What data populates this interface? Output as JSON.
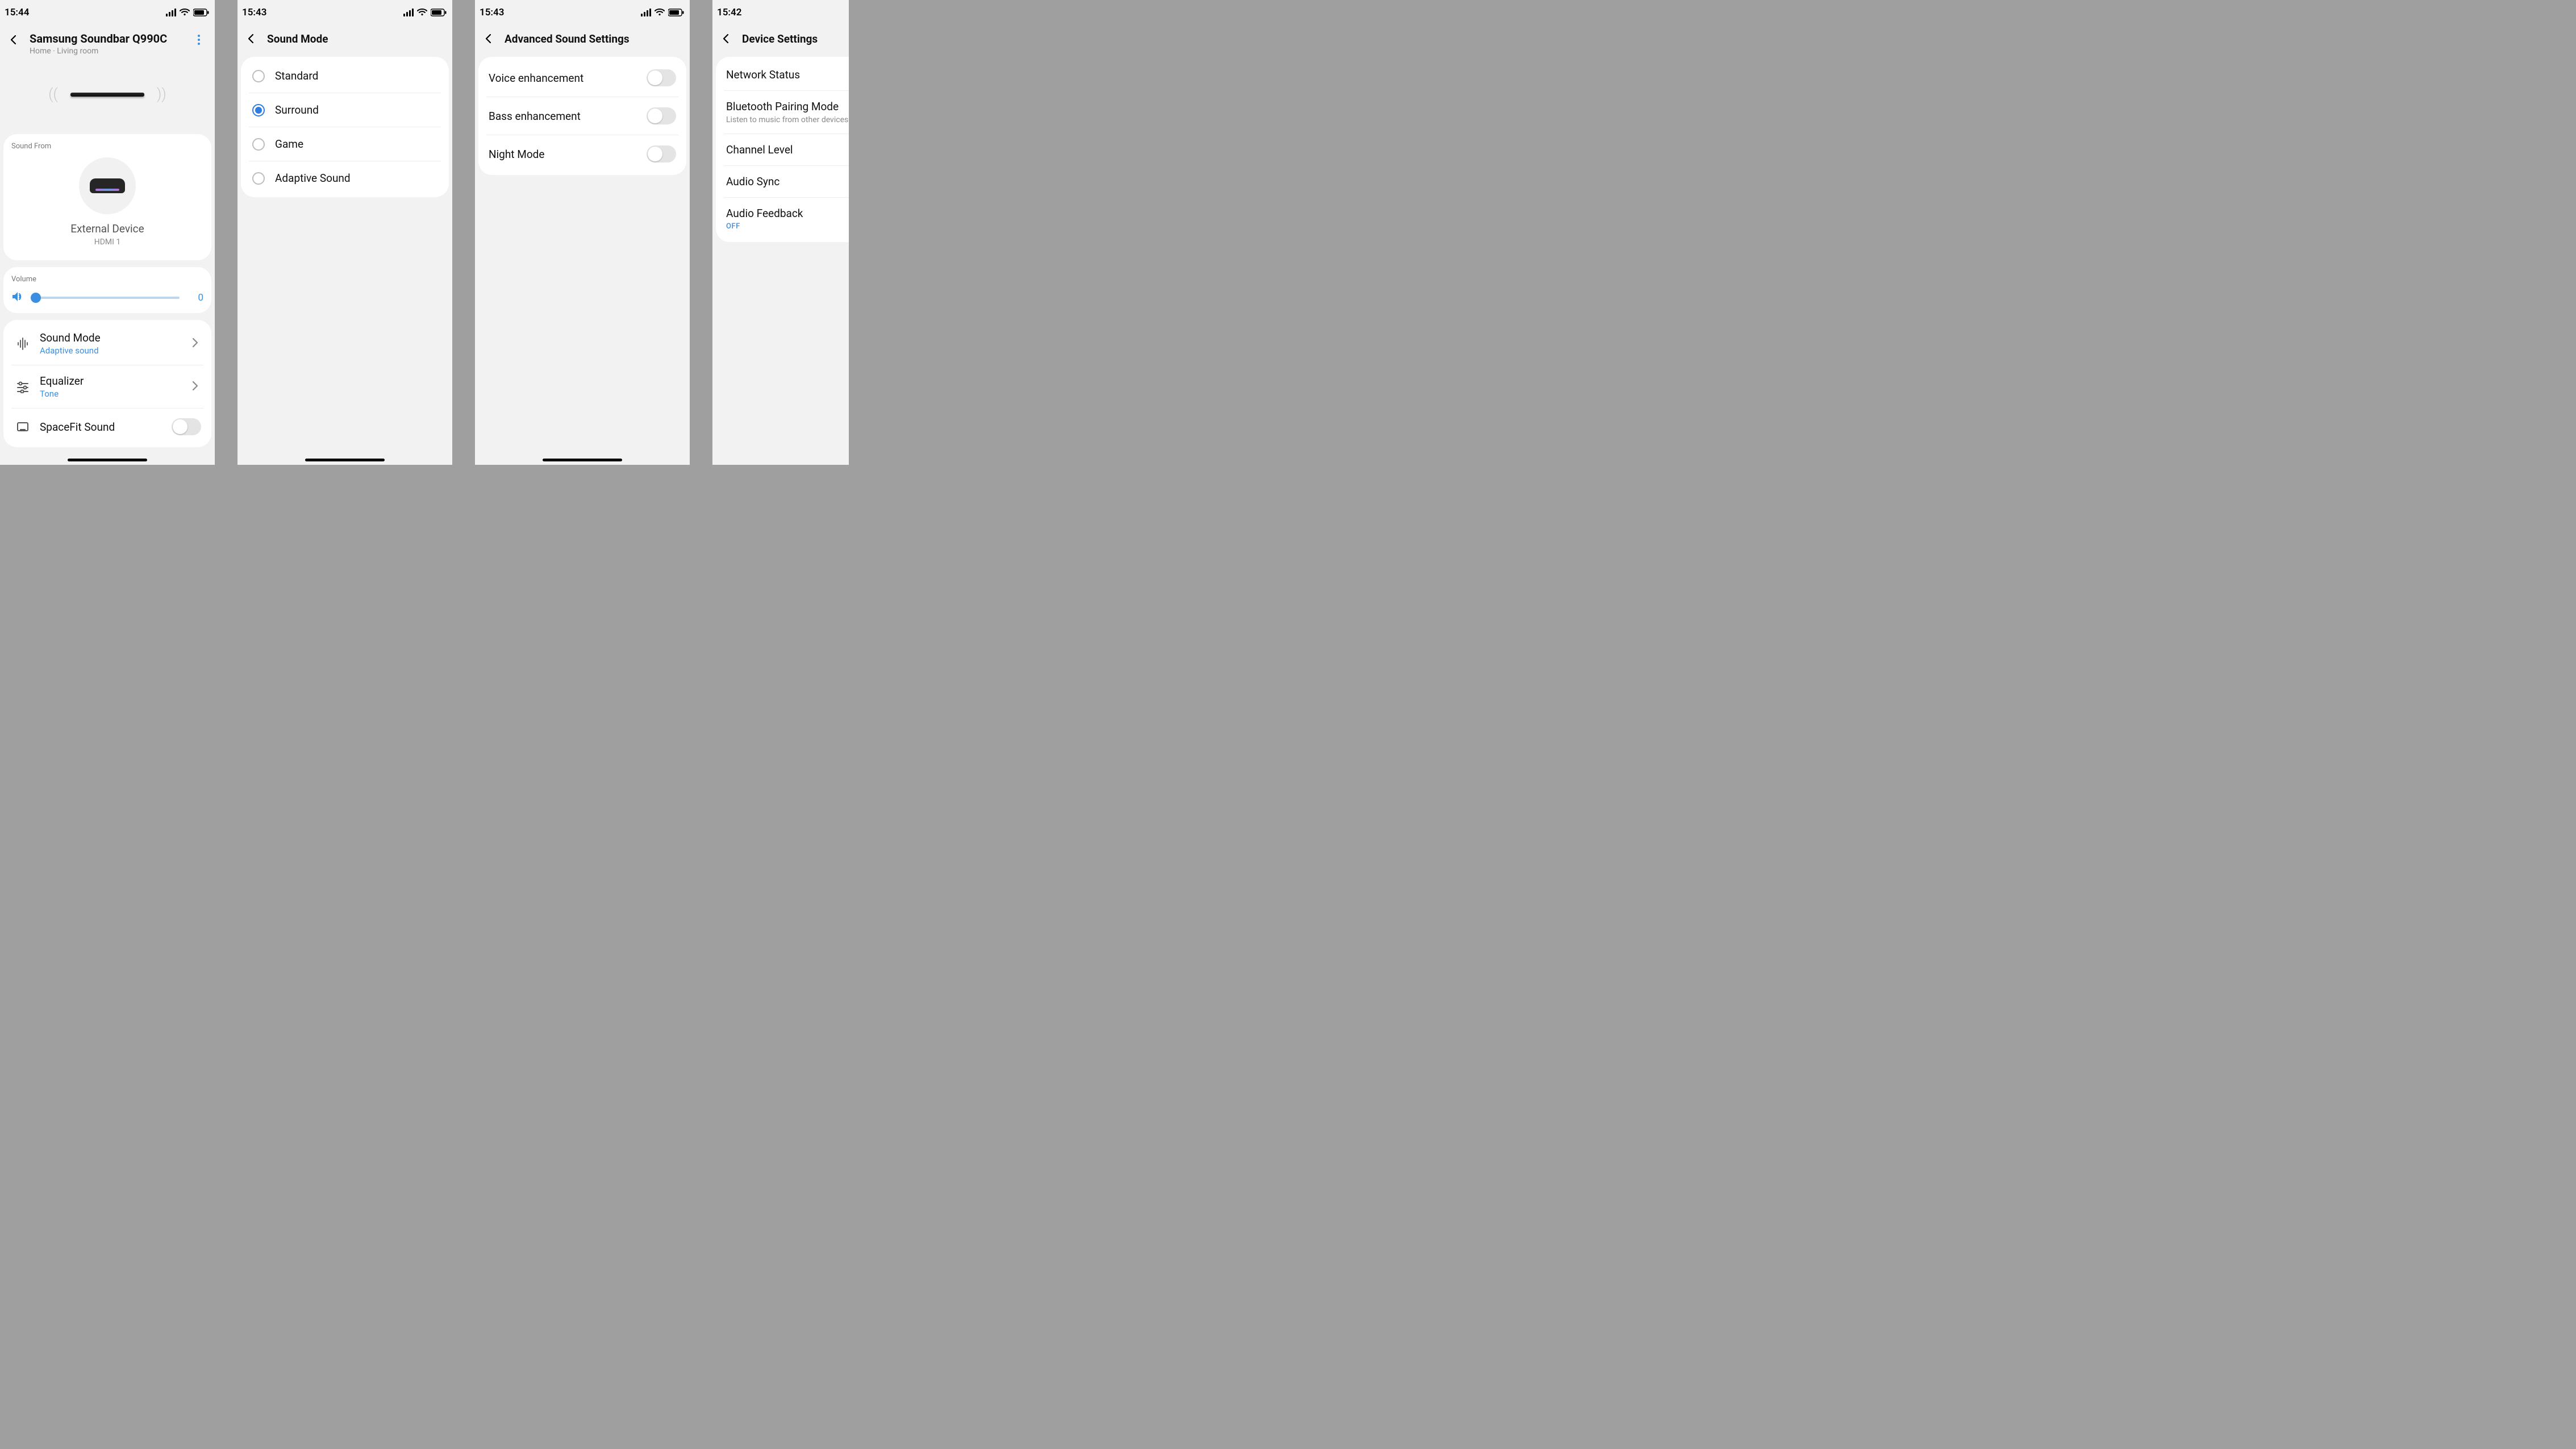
{
  "status": {
    "times": [
      "15:44",
      "15:43",
      "15:43",
      "15:42"
    ]
  },
  "screen1": {
    "title": "Samsung Soundbar Q990C",
    "subtitle": "Home · Living room",
    "sound_from_label": "Sound From",
    "sound_from_name": "External Device",
    "sound_from_port": "HDMI 1",
    "volume_label": "Volume",
    "volume_value": "0",
    "rows": [
      {
        "title": "Sound Mode",
        "sub": "Adaptive sound"
      },
      {
        "title": "Equalizer",
        "sub": "Tone"
      },
      {
        "title": "SpaceFit Sound",
        "sub": ""
      }
    ]
  },
  "screen2": {
    "title": "Sound Mode",
    "options": [
      {
        "label": "Standard",
        "selected": false
      },
      {
        "label": "Surround",
        "selected": true
      },
      {
        "label": "Game",
        "selected": false
      },
      {
        "label": "Adaptive Sound",
        "selected": false
      }
    ]
  },
  "screen3": {
    "title": "Advanced Sound Settings",
    "toggles": [
      {
        "label": "Voice enhancement",
        "on": false
      },
      {
        "label": "Bass enhancement",
        "on": false
      },
      {
        "label": "Night Mode",
        "on": false
      }
    ]
  },
  "screen4": {
    "title": "Device Settings",
    "items": [
      {
        "primary": "Network Status"
      },
      {
        "primary": "Bluetooth Pairing Mode",
        "secondary": "Listen to music from other devices"
      },
      {
        "primary": "Channel Level"
      },
      {
        "primary": "Audio Sync"
      },
      {
        "primary": "Audio Feedback",
        "status": "OFF"
      }
    ]
  }
}
